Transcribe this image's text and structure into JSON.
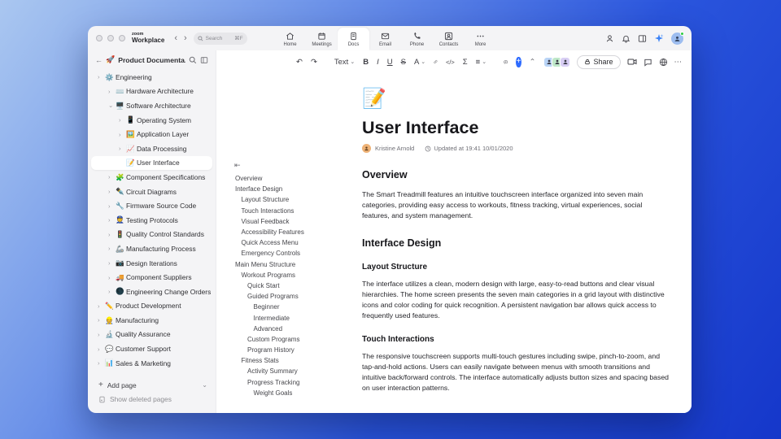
{
  "window": {
    "logo": {
      "top": "zoom",
      "bottom": "Workplace"
    },
    "nav": {
      "back": "‹",
      "forward": "›"
    },
    "search": {
      "placeholder": "Search",
      "shortcut": "⌘F"
    },
    "tabs": [
      {
        "label": "Home"
      },
      {
        "label": "Meetings"
      },
      {
        "label": "Docs",
        "active": true
      },
      {
        "label": "Email"
      },
      {
        "label": "Phone"
      },
      {
        "label": "Contacts"
      },
      {
        "label": "More"
      }
    ],
    "sparkle_color": "#3b82f6"
  },
  "sidebar": {
    "back_arrow": "←",
    "workspace_emoji": "🚀",
    "workspace_emoji_color": "#d93025",
    "title": "Product Documenta...",
    "items": [
      {
        "label": "Engineering",
        "emoji": "⚙️",
        "color": "#5f6368",
        "level": 0,
        "chev": "›"
      },
      {
        "label": "Hardware Architecture",
        "emoji": "⌨️",
        "color": "#9aa0a6",
        "level": 1,
        "chev": "›"
      },
      {
        "label": "Software Architecture",
        "emoji": "🖥️",
        "color": "#3c4043",
        "level": 1,
        "chev": "⌄"
      },
      {
        "label": "Operating System",
        "emoji": "📱",
        "color": "#202124",
        "level": 2,
        "chev": "›"
      },
      {
        "label": "Application Layer",
        "emoji": "🖼️",
        "color": "#e8894a",
        "level": 2,
        "chev": "›"
      },
      {
        "label": "Data Processing",
        "emoji": "📈",
        "color": "#d93025",
        "level": 2,
        "chev": "›"
      },
      {
        "label": "User Interface",
        "emoji": "📝",
        "color": "#f2b51c",
        "level": 2,
        "chev": "",
        "selected": true
      },
      {
        "label": "Component Specifications",
        "emoji": "🧩",
        "color": "#34a853",
        "level": 1,
        "chev": "›"
      },
      {
        "label": "Circuit Diagrams",
        "emoji": "✒️",
        "color": "#202124",
        "level": 1,
        "chev": "›"
      },
      {
        "label": "Firmware Source Code",
        "emoji": "🔧",
        "color": "#9aa0a6",
        "level": 1,
        "chev": "›"
      },
      {
        "label": "Testing Protocols",
        "emoji": "👮",
        "color": "#1967d2",
        "level": 1,
        "chev": "›"
      },
      {
        "label": "Quality Control Standards",
        "emoji": "🚦",
        "color": "#3c4043",
        "level": 1,
        "chev": "›"
      },
      {
        "label": "Manufacturing Process",
        "emoji": "🦾",
        "color": "#5f6368",
        "level": 1,
        "chev": "›"
      },
      {
        "label": "Design Iterations",
        "emoji": "📷",
        "color": "#5f6368",
        "level": 1,
        "chev": "›"
      },
      {
        "label": "Component Suppliers",
        "emoji": "🚚",
        "color": "#d93025",
        "level": 1,
        "chev": "›"
      },
      {
        "label": "Engineering Change Orders",
        "emoji": "🌑",
        "color": "#3c4043",
        "level": 1,
        "chev": "›"
      },
      {
        "label": "Product Development",
        "emoji": "✏️",
        "color": "#34a853",
        "level": 0,
        "chev": "›"
      },
      {
        "label": "Manufacturing",
        "emoji": "👷",
        "color": "#f9ab00",
        "level": 0,
        "chev": "›"
      },
      {
        "label": "Quality Assurance",
        "emoji": "🔬",
        "color": "#5f6368",
        "level": 0,
        "chev": "›"
      },
      {
        "label": "Customer Support",
        "emoji": "💬",
        "color": "#9aa0a6",
        "level": 0,
        "chev": "›"
      },
      {
        "label": "Sales & Marketing",
        "emoji": "📊",
        "color": "#f9ab00",
        "level": 0,
        "chev": "›"
      }
    ],
    "add_page_label": "Add page",
    "show_deleted_label": "Show deleted pages"
  },
  "outline": {
    "collapse_icon": "⇤",
    "items": [
      {
        "label": "Overview",
        "level": 0
      },
      {
        "label": "Interface Design",
        "level": 0
      },
      {
        "label": "Layout Structure",
        "level": 1
      },
      {
        "label": "Touch Interactions",
        "level": 1
      },
      {
        "label": "Visual Feedback",
        "level": 1
      },
      {
        "label": "Accessibility Features",
        "level": 1
      },
      {
        "label": "Quick Access Menu",
        "level": 1
      },
      {
        "label": "Emergency Controls",
        "level": 1
      },
      {
        "label": "Main Menu Structure",
        "level": 0
      },
      {
        "label": "Workout Programs",
        "level": 1
      },
      {
        "label": "Quick Start",
        "level": 2
      },
      {
        "label": "Guided Programs",
        "level": 2
      },
      {
        "label": "Beginner",
        "level": 3
      },
      {
        "label": "Intermediate",
        "level": 3
      },
      {
        "label": "Advanced",
        "level": 3
      },
      {
        "label": "Custom Programs",
        "level": 2
      },
      {
        "label": "Program History",
        "level": 2
      },
      {
        "label": "Fitness Stats",
        "level": 1
      },
      {
        "label": "Activity Summary",
        "level": 2
      },
      {
        "label": "Progress Tracking",
        "level": 2
      },
      {
        "label": "Weight Goals",
        "level": 3
      }
    ]
  },
  "doc_toolbar": {
    "undo": "↶",
    "redo": "↷",
    "text_style_label": "Text",
    "bold": "B",
    "italic": "I",
    "underline": "U",
    "strikethrough": "S",
    "text_color": "A",
    "formula": "Σ",
    "code": "</>",
    "align": "≡",
    "collapse": "⌃",
    "more": "⋯",
    "share_label": "Share",
    "avatar_colors": [
      "#b9d4f6",
      "#bfe8c9",
      "#d8cef4"
    ]
  },
  "doc": {
    "emoji": "📝",
    "title": "User Interface",
    "author": "Kristine Arnold",
    "updated": "Updated at 19:41 10/01/2020",
    "sections": [
      {
        "type": "h2",
        "text": "Overview"
      },
      {
        "type": "p",
        "text": "The Smart Treadmill features an intuitive touchscreen interface organized into seven main categories, providing easy access to workouts, fitness tracking, virtual experiences, social features, and system management."
      },
      {
        "type": "h2",
        "text": "Interface Design"
      },
      {
        "type": "h3",
        "text": "Layout Structure"
      },
      {
        "type": "p",
        "text": "The interface utilizes a clean, modern design with large, easy-to-read buttons and clear visual hierarchies. The home screen presents the seven main categories in a grid layout with distinctive icons and color coding for quick recognition. A persistent navigation bar allows quick access to frequently used features."
      },
      {
        "type": "h3",
        "text": "Touch Interactions"
      },
      {
        "type": "p",
        "text": "The responsive touchscreen supports multi-touch gestures including swipe, pinch-to-zoom, and tap-and-hold actions. Users can easily navigate between menus with smooth transitions and intuitive back/forward controls. The interface automatically adjusts button sizes and spacing based on user interaction patterns."
      }
    ]
  }
}
